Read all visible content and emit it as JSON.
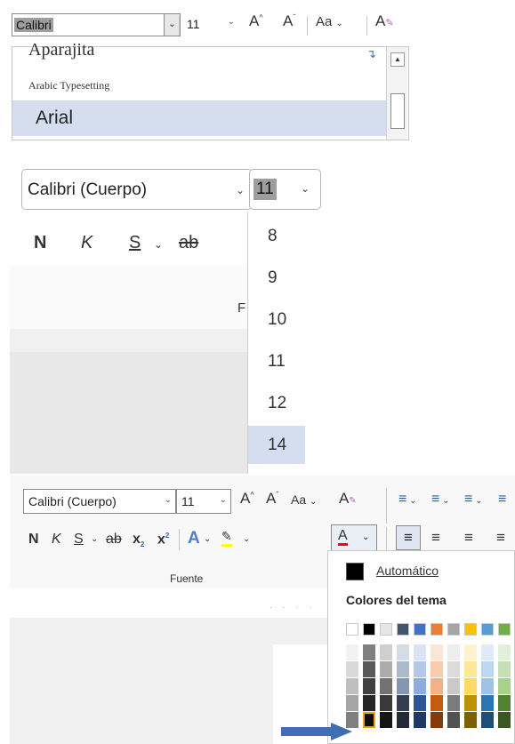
{
  "panel1": {
    "font_value": "Calibri",
    "size_value": "11",
    "grow_label": "A",
    "shrink_label": "A",
    "case_label": "Aa",
    "list": [
      {
        "label": "Aparajita"
      },
      {
        "label": "Arabic Typesetting"
      },
      {
        "label": "Arial"
      }
    ]
  },
  "panel2": {
    "font_value": "Calibri (Cuerpo)",
    "size_value": "11",
    "bold": "N",
    "italic": "K",
    "underline": "S",
    "strike": "ab",
    "partial_label": "F",
    "sizes": [
      "8",
      "9",
      "10",
      "11",
      "12",
      "14"
    ],
    "selected_size": "14"
  },
  "panel3": {
    "font_value": "Calibri (Cuerpo)",
    "size_value": "11",
    "grow_label": "A",
    "shrink_label": "A",
    "case_label": "Aa",
    "bold": "N",
    "italic": "K",
    "underline": "S",
    "strike": "ab",
    "subscript": "x",
    "superscript": "x",
    "text_effect": "A",
    "font_color_label": "A",
    "group_label": "Fuente",
    "color_menu": {
      "automatic": "Automático",
      "theme_title": "Colores del tema",
      "theme_colors": [
        "#ffffff",
        "#000000",
        "#e7e6e6",
        "#44546a",
        "#4472c4",
        "#ed7d31",
        "#a5a5a5",
        "#ffc000",
        "#5b9bd5",
        "#70ad47"
      ],
      "shade_columns": [
        [
          "#f2f2f2",
          "#d9d9d9",
          "#bfbfbf",
          "#a6a6a6",
          "#808080"
        ],
        [
          "#808080",
          "#595959",
          "#404040",
          "#262626",
          "#0d0d0d"
        ],
        [
          "#d0cece",
          "#aeabab",
          "#757171",
          "#3a3838",
          "#171616"
        ],
        [
          "#d6dce4",
          "#adb9ca",
          "#8497b0",
          "#333f4f",
          "#222a35"
        ],
        [
          "#dae3f3",
          "#b4c7e7",
          "#8faadc",
          "#2f5597",
          "#1f3864"
        ],
        [
          "#fbe5d6",
          "#f8cbad",
          "#f4b183",
          "#c55a11",
          "#843c0c"
        ],
        [
          "#ededed",
          "#dbdbdb",
          "#c9c9c9",
          "#7b7b7b",
          "#525252"
        ],
        [
          "#fff2cc",
          "#ffe699",
          "#ffd966",
          "#bf9000",
          "#7f6000"
        ],
        [
          "#deebf7",
          "#bdd7ee",
          "#9dc3e6",
          "#2e75b6",
          "#1f4e79"
        ],
        [
          "#e2f0d9",
          "#c5e0b4",
          "#a9d18e",
          "#548235",
          "#385723"
        ]
      ],
      "selected": "#0d0d0d"
    }
  },
  "colors": {
    "selection_blue": "#d4deef",
    "arrow_blue": "#3f6fb2",
    "font_color_red": "#ff0000",
    "highlight_yellow": "#ffff00",
    "selected_outline": "#f0a000"
  }
}
